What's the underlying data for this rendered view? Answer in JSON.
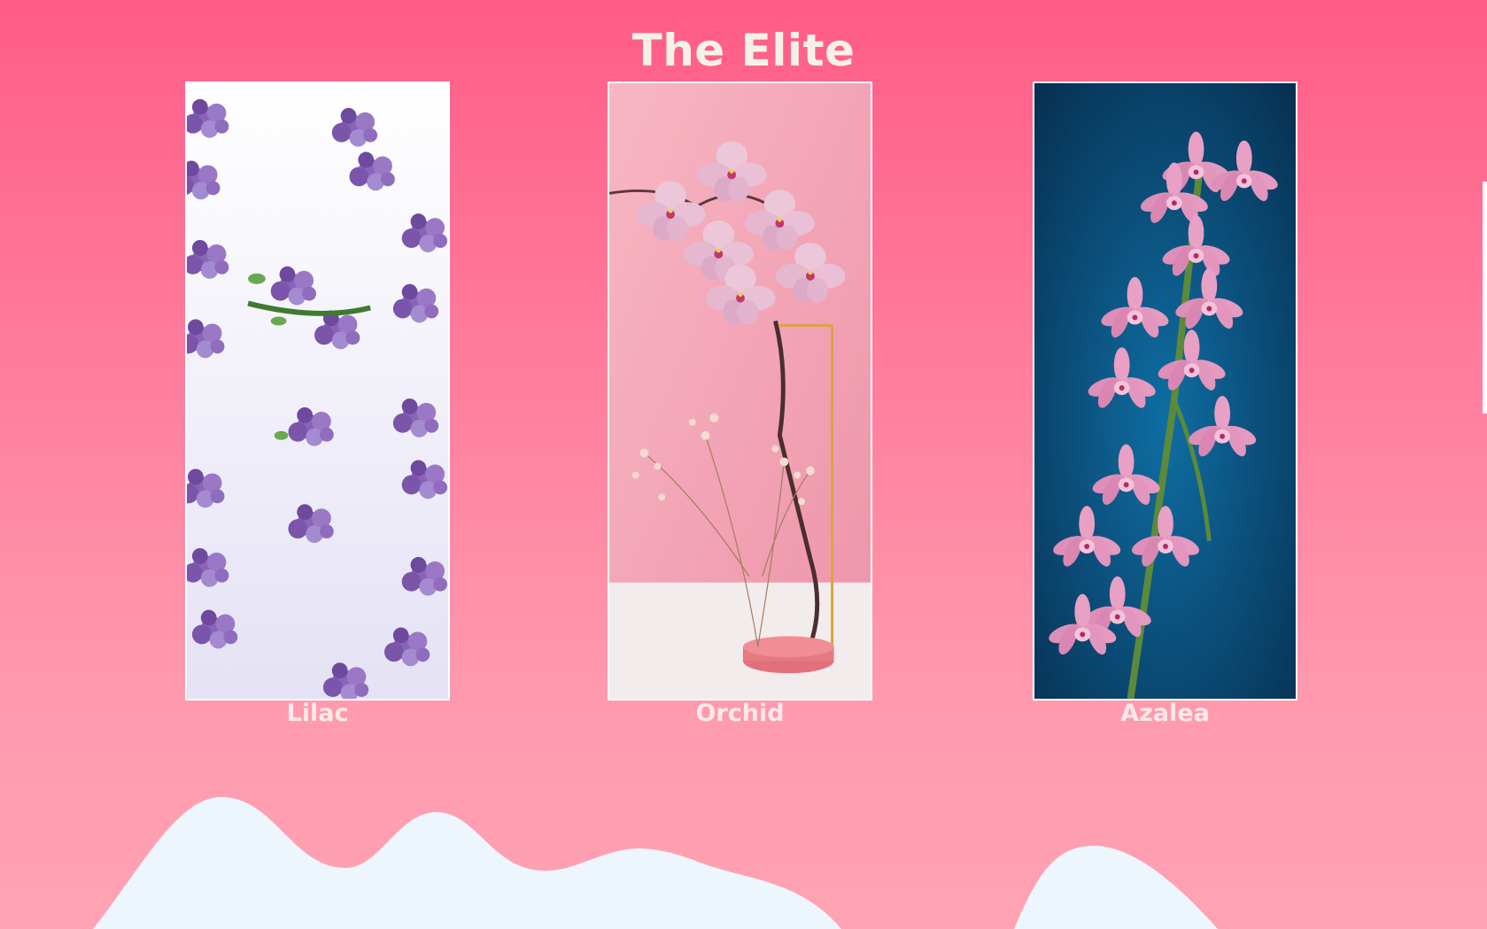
{
  "page": {
    "title": "The Elite"
  },
  "gallery": {
    "items": [
      {
        "label": "Lilac",
        "image": "lilac-photo",
        "colors": {
          "background": "#efeefa",
          "flower": "#8a64b8"
        }
      },
      {
        "label": "Orchid",
        "image": "orchid-photo",
        "colors": {
          "background": "#f6a9b8",
          "flower": "#ecc6d9"
        }
      },
      {
        "label": "Azalea",
        "image": "azalea-photo",
        "colors": {
          "background": "#0d5e8e",
          "flower": "#e8a0c4"
        }
      }
    ]
  },
  "theme": {
    "background_top": "#ff5c87",
    "background_bottom": "#ffa3b3",
    "title_color": "#f6f1e6",
    "wave_color": "#eef6fd"
  }
}
